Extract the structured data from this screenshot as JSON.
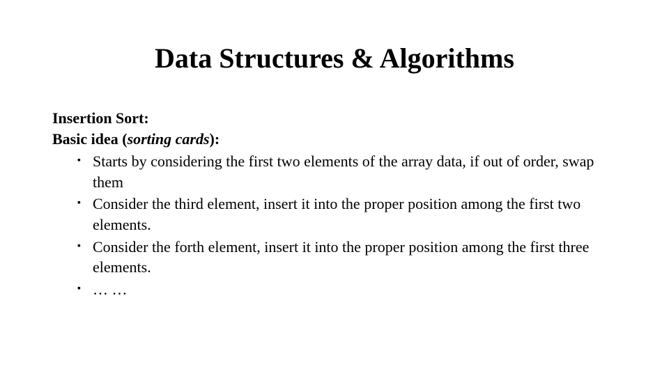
{
  "title": "Data Structures & Algorithms",
  "subheading": "Insertion Sort:",
  "subheading2_prefix": "Basic idea (",
  "subheading2_italic": "sorting cards",
  "subheading2_suffix": "):",
  "bullets": [
    "Starts by considering the first two elements of the array data, if out of order, swap them",
    "Consider the third element, insert it into the proper  position among the first two elements.",
    "Consider the forth element, insert it into the proper position among the first three elements.",
    "… …"
  ]
}
